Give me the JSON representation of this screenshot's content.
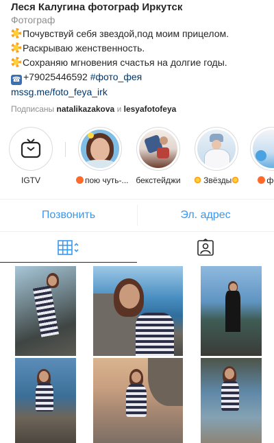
{
  "profile": {
    "name": "Леся Калугина фотограф Иркутск",
    "category": "Фотограф",
    "bio": [
      "Почувствуй себя звездой,под моим прицелом.",
      "Раскрываю женственность.",
      "Сохраняю мгновения счастья на долгие годы."
    ],
    "phone": "+79025446592",
    "hashtag": "#фото_фея",
    "link": "mssg.me/foto_feya_irk",
    "followed_prefix": "Подписаны",
    "followed_user1": "natalikazakova",
    "followed_and": "и",
    "followed_user2": "lesyafotofeya"
  },
  "highlights": [
    {
      "label": "IGTV",
      "icon": "igtv-icon"
    },
    {
      "label": "пою чуть-...",
      "icon": "singer-photo"
    },
    {
      "label": "бекстейджи",
      "icon": "backstage-photo"
    },
    {
      "label": "Звёзды",
      "icon": "stars-photo"
    },
    {
      "label": "феяк",
      "icon": "fairy-photo"
    }
  ],
  "actions": {
    "call_label": "Позвонить",
    "email_label": "Эл. адрес"
  },
  "tabs": {
    "grid_icon": "grid-icon",
    "tagged_icon": "tagged-icon"
  },
  "colors": {
    "accent": "#3897f0",
    "link": "#00376b",
    "text": "#262626",
    "muted": "#8e8e8e"
  }
}
